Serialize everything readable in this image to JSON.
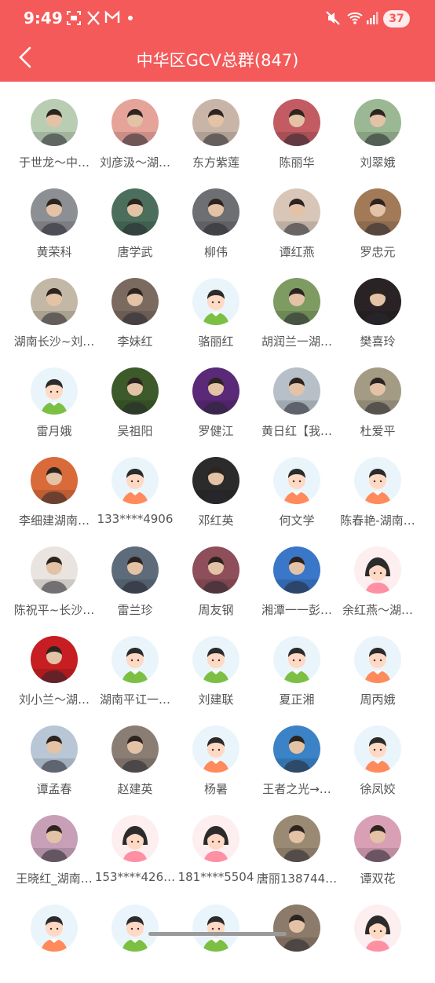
{
  "status": {
    "time": "9:49",
    "battery": "37"
  },
  "header": {
    "title": "中华区GCV总群(847)"
  },
  "colors": {
    "header_bg": "#f45a5a",
    "name_text": "#555555"
  },
  "members": [
    {
      "name": "于世龙～中…",
      "avatar": "photo",
      "bg": "#b9cdb3"
    },
    {
      "name": "刘彦汲～湖…",
      "avatar": "photo",
      "bg": "#e5a39a"
    },
    {
      "name": "东方紫莲",
      "avatar": "photo",
      "bg": "#c9b5a8"
    },
    {
      "name": "陈丽华",
      "avatar": "photo",
      "bg": "#c35b63"
    },
    {
      "name": "刘翠娥",
      "avatar": "photo",
      "bg": "#9bb895"
    },
    {
      "name": "黄荣科",
      "avatar": "photo",
      "bg": "#8c8f93"
    },
    {
      "name": "唐学武",
      "avatar": "photo",
      "bg": "#4b6f5c"
    },
    {
      "name": "柳伟",
      "avatar": "photo",
      "bg": "#6e6f72"
    },
    {
      "name": "谭红燕",
      "avatar": "photo",
      "bg": "#d8c7b9"
    },
    {
      "name": "罗忠元",
      "avatar": "photo",
      "bg": "#a27a58"
    },
    {
      "name": "湖南长沙~刘…",
      "avatar": "photo",
      "bg": "#c3b8a6"
    },
    {
      "name": "李妹红",
      "avatar": "photo",
      "bg": "#7a6a5f"
    },
    {
      "name": "骆丽红",
      "avatar": "cartoon-boy-green",
      "bg": "#eaf5fb"
    },
    {
      "name": "胡润兰一湖…",
      "avatar": "photo",
      "bg": "#7e9b62"
    },
    {
      "name": "樊喜玲",
      "avatar": "photo",
      "bg": "#2a2326"
    },
    {
      "name": "雷月娥",
      "avatar": "cartoon-boy-green",
      "bg": "#eaf5fb"
    },
    {
      "name": "吴祖阳",
      "avatar": "photo",
      "bg": "#3c5a2a"
    },
    {
      "name": "罗健江",
      "avatar": "photo",
      "bg": "#5a2a78"
    },
    {
      "name": "黄日红【我…",
      "avatar": "photo",
      "bg": "#b7c0c9"
    },
    {
      "name": "杜爱平",
      "avatar": "photo",
      "bg": "#a39b84"
    },
    {
      "name": "李细建湖南…",
      "avatar": "photo",
      "bg": "#d96a3a"
    },
    {
      "name": "133****4906",
      "avatar": "cartoon-boy-orange",
      "bg": "#eaf5fb"
    },
    {
      "name": "邓红英",
      "avatar": "photo",
      "bg": "#2b2b2b"
    },
    {
      "name": "何文学",
      "avatar": "cartoon-boy-orange",
      "bg": "#eaf5fb"
    },
    {
      "name": "陈春艳-湖南…",
      "avatar": "cartoon-boy-orange",
      "bg": "#eaf5fb"
    },
    {
      "name": "陈祝平~长沙…",
      "avatar": "photo",
      "bg": "#e9e4df"
    },
    {
      "name": "雷兰珍",
      "avatar": "photo",
      "bg": "#5d6b7a"
    },
    {
      "name": "周友钢",
      "avatar": "photo",
      "bg": "#8e4f5a"
    },
    {
      "name": "湘潭一一彭…",
      "avatar": "photo",
      "bg": "#3a77c9"
    },
    {
      "name": "余红燕～湖…",
      "avatar": "cartoon-girl",
      "bg": "#fdeef0"
    },
    {
      "name": "刘小兰～湖…",
      "avatar": "photo",
      "bg": "#c61e22"
    },
    {
      "name": "湖南平讧一…",
      "avatar": "cartoon-boy-green",
      "bg": "#eaf5fb"
    },
    {
      "name": "刘建联",
      "avatar": "cartoon-boy-green",
      "bg": "#eaf5fb"
    },
    {
      "name": "夏正湘",
      "avatar": "cartoon-boy-green",
      "bg": "#eaf5fb"
    },
    {
      "name": "周丙娥",
      "avatar": "cartoon-boy-orange",
      "bg": "#eaf5fb"
    },
    {
      "name": "谭孟春",
      "avatar": "photo",
      "bg": "#b8c6d6"
    },
    {
      "name": "赵建英",
      "avatar": "photo",
      "bg": "#8a7d74"
    },
    {
      "name": "杨暑",
      "avatar": "cartoon-boy-orange",
      "bg": "#eaf5fb"
    },
    {
      "name": "王者之光→…",
      "avatar": "photo",
      "bg": "#3b83c6"
    },
    {
      "name": "徐凤姣",
      "avatar": "cartoon-boy-orange",
      "bg": "#eaf5fb"
    },
    {
      "name": "王晓红_湖南…",
      "avatar": "photo",
      "bg": "#c7a0b8"
    },
    {
      "name": "153****426…",
      "avatar": "cartoon-girl",
      "bg": "#fdeef0"
    },
    {
      "name": "181****5504",
      "avatar": "cartoon-girl",
      "bg": "#fdeef0"
    },
    {
      "name": "唐丽138744…",
      "avatar": "photo",
      "bg": "#9a8a74"
    },
    {
      "name": "谭双花",
      "avatar": "photo",
      "bg": "#d9a0b5"
    },
    {
      "name": "",
      "avatar": "cartoon-boy-orange",
      "bg": "#eaf5fb"
    },
    {
      "name": "",
      "avatar": "cartoon-boy-green",
      "bg": "#eaf5fb"
    },
    {
      "name": "",
      "avatar": "cartoon-boy-green",
      "bg": "#eaf5fb"
    },
    {
      "name": "",
      "avatar": "photo",
      "bg": "#8c7a6a"
    },
    {
      "name": "",
      "avatar": "cartoon-girl",
      "bg": "#fdeef0"
    }
  ]
}
